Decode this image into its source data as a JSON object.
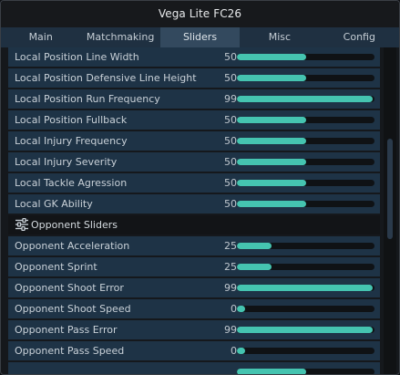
{
  "window": {
    "title": "Vega Lite FC26"
  },
  "tabs": [
    {
      "label": "Main",
      "active": false
    },
    {
      "label": "Matchmaking",
      "active": false
    },
    {
      "label": "Sliders",
      "active": true
    },
    {
      "label": "Misc",
      "active": false
    },
    {
      "label": "Config",
      "active": false
    }
  ],
  "colors": {
    "accent": "#45c4b0",
    "row_bg": "#1e3346",
    "tab_bar": "#1f3041",
    "tab_active": "#33495e"
  },
  "sliders_local": [
    {
      "label": "Local Position Line Width",
      "value": "50",
      "fraction": 0.5
    },
    {
      "label": "Local Position Defensive Line Height",
      "value": "50",
      "fraction": 0.5
    },
    {
      "label": "Local Position Run Frequency",
      "value": "99",
      "fraction": 0.99
    },
    {
      "label": "Local Position Fullback",
      "value": "50",
      "fraction": 0.5
    },
    {
      "label": "Local Injury Frequency",
      "value": "50",
      "fraction": 0.5
    },
    {
      "label": "Local Injury Severity",
      "value": "50",
      "fraction": 0.5
    },
    {
      "label": "Local Tackle Agression",
      "value": "50",
      "fraction": 0.5
    },
    {
      "label": "Local GK Ability",
      "value": "50",
      "fraction": 0.5
    }
  ],
  "opponent_section": {
    "label": "Opponent Sliders",
    "icon": "sliders-icon"
  },
  "sliders_opponent": [
    {
      "label": "Opponent Acceleration",
      "value": "25",
      "fraction": 0.25
    },
    {
      "label": "Opponent Sprint",
      "value": "25",
      "fraction": 0.25
    },
    {
      "label": "Opponent Shoot Error",
      "value": "99",
      "fraction": 0.99
    },
    {
      "label": "Opponent Shoot Speed",
      "value": "0",
      "fraction": 0.0
    },
    {
      "label": "Opponent Pass Error",
      "value": "99",
      "fraction": 0.99
    },
    {
      "label": "Opponent Pass Speed",
      "value": "0",
      "fraction": 0.0
    }
  ]
}
